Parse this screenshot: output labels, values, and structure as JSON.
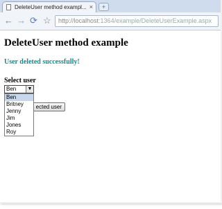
{
  "browser": {
    "tab_title": "DeleteUser method exampl...",
    "close_glyph": "×",
    "new_tab_glyph": "+",
    "url_base": "http://localhost",
    "url_path": ":1364/example/DeleteUserExample.aspx",
    "back_glyph": "←",
    "forward_glyph": "→",
    "reload_glyph": "⟳",
    "star_glyph": "☆"
  },
  "page": {
    "title": "DeleteUser method example",
    "status_message": "User deleted successfully!",
    "select_label": "Select user",
    "selected_value": "Ben",
    "options": [
      "Ben",
      "Britney",
      "Jenny",
      "Jim",
      "Jones",
      "Roy"
    ],
    "button_label": "ected user",
    "status_color": "#148a8a"
  }
}
